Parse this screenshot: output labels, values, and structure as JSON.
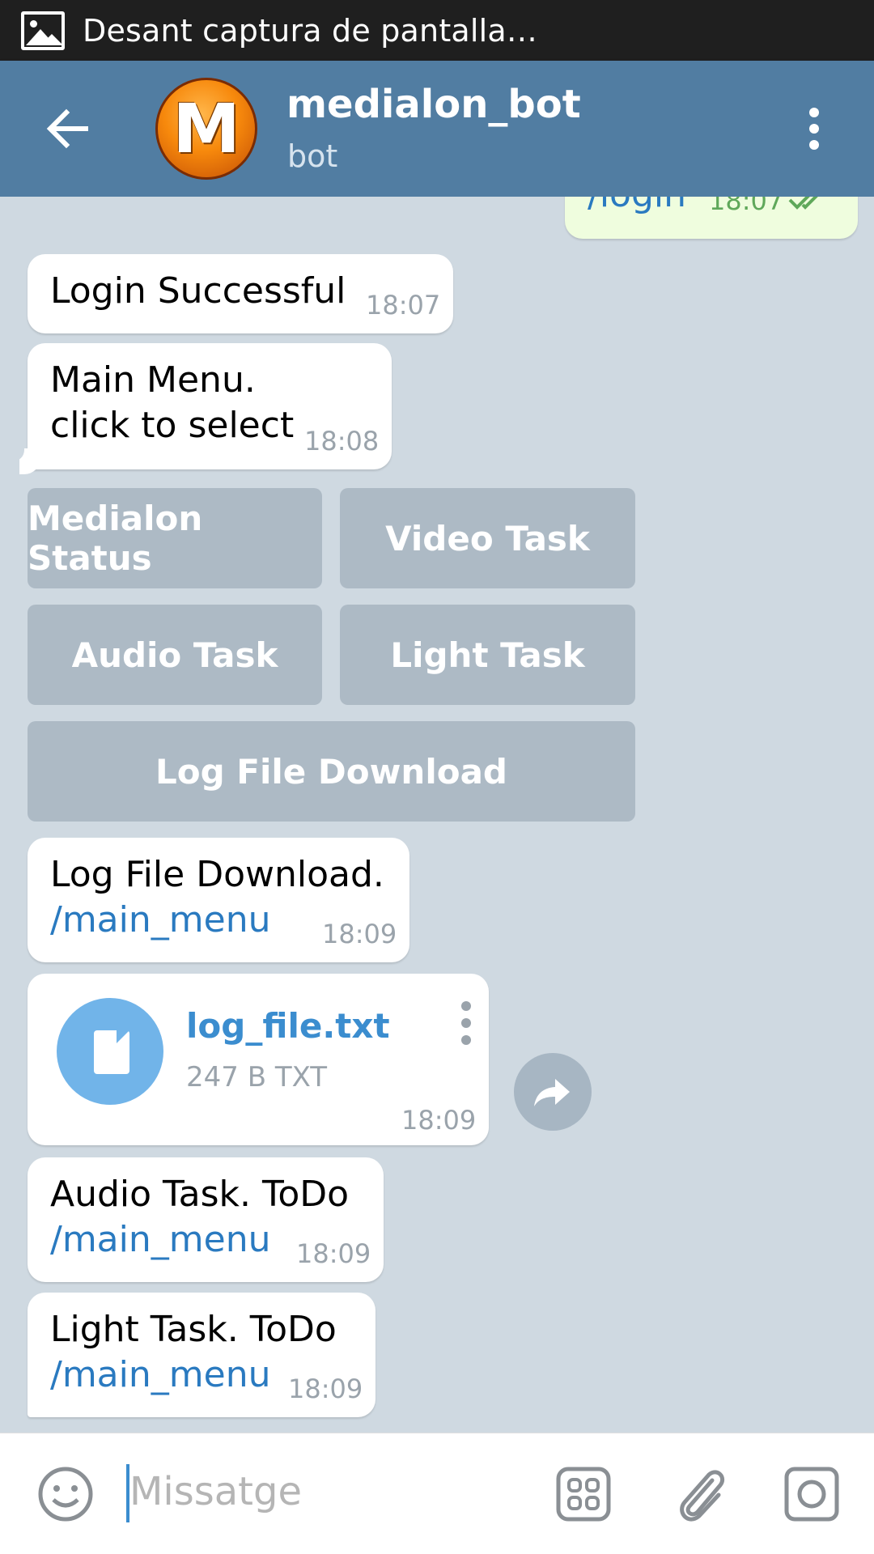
{
  "status_bar": {
    "text": "Desant captura de pantalla…"
  },
  "header": {
    "title": "medialon_bot",
    "subtitle": "bot",
    "avatar_letter": "M"
  },
  "messages": {
    "outgoing_partial": {
      "text": "/login",
      "time": "18:07"
    },
    "m1": {
      "text": "Login Successful",
      "time": "18:07"
    },
    "m2": {
      "line1": "Main Menu.",
      "line2": "click to select",
      "time": "18:08"
    },
    "m3": {
      "text": "Log File Download.",
      "link": "/main_menu",
      "time": "18:09"
    },
    "file": {
      "name": "log_file.txt",
      "meta": "247 B TXT",
      "time": "18:09"
    },
    "m4": {
      "text": "Audio Task. ToDo",
      "link": "/main_menu",
      "time": "18:09"
    },
    "m5": {
      "text": "Light Task. ToDo",
      "link": "/main_menu",
      "time": "18:09"
    }
  },
  "keyboard": {
    "medialon_status": "Medialon Status",
    "video_task": "Video Task",
    "audio_task": "Audio Task",
    "light_task": "Light Task",
    "log_file_download": "Log File Download"
  },
  "input": {
    "placeholder": "Missatge"
  },
  "colors": {
    "header": "#517da2",
    "link": "#2a7ac0",
    "file_icon": "#71b4e9"
  }
}
